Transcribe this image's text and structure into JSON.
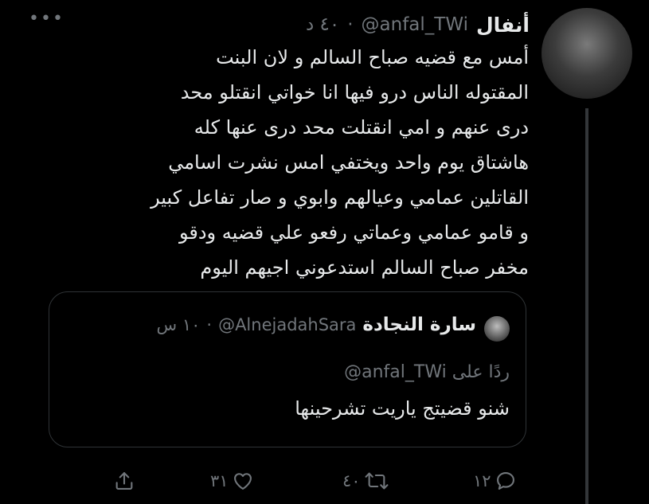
{
  "tweet": {
    "name": "أنفال",
    "handle": "@anfal_TWi",
    "dot": "·",
    "time": "٤٠ د",
    "lines": [
      "أمس مع قضيه صباح السالم و لان البنت",
      "المقتوله الناس درو فيها انا خواتي انقتلو محد",
      "درى عنهم و امي انقتلت محد درى عنها كله",
      "هاشتاق يوم واحد ويختفي امس نشرت اسامي",
      "القاتلين عمامي وعيالهم وابوي و صار تفاعل كبير",
      "و قامو عمامي وعماتي رفعو علي قضيه ودقو",
      "مخفر صباح السالم استدعوني اجيهم اليوم"
    ]
  },
  "quote": {
    "name": "سارة النجادة",
    "handle": "@AlnejadahSara",
    "dot": "·",
    "time": "١٠ س",
    "reply_prefix": "ردًا على",
    "reply_handle": "@anfal_TWi",
    "text": "شنو قضيتج ياريت تشرحينها"
  },
  "actions": {
    "reply_count": "١٢",
    "retweet_count": "٤٠",
    "like_count": "٣١"
  },
  "icons": {
    "more": "more-icon",
    "reply": "reply-icon",
    "retweet": "retweet-icon",
    "like": "heart-icon",
    "share": "share-icon"
  },
  "colors": {
    "background": "#000000",
    "text": "#e7e9ea",
    "secondary": "#71767b",
    "border": "#2f3336"
  }
}
